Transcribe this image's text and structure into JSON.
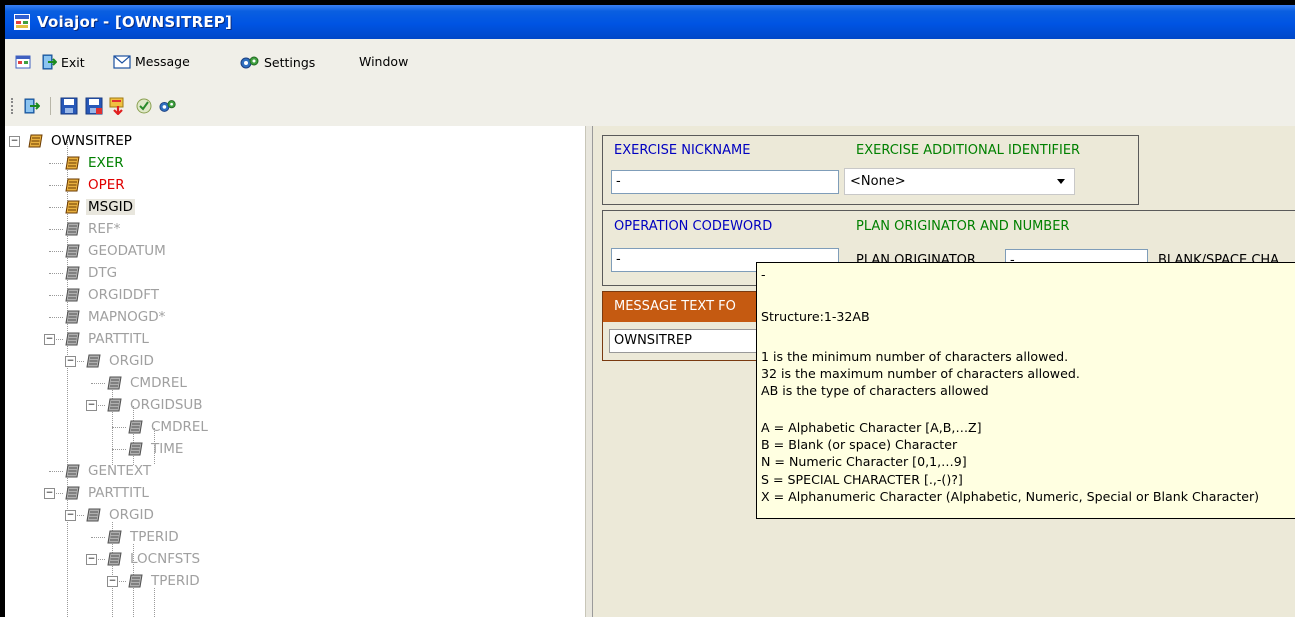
{
  "window": {
    "title": "Voiajor - [OWNSITREP]"
  },
  "menu": {
    "items": [
      {
        "label": "Exit",
        "icon": "exit-icon"
      },
      {
        "label": "Message",
        "icon": "envelope-icon"
      },
      {
        "label": "Settings",
        "icon": "settings-icon"
      },
      {
        "label": "Window",
        "icon": ""
      }
    ]
  },
  "toolbar": {
    "icons": [
      "exit-icon",
      "save-icon",
      "save-as-icon",
      "export-icon",
      "validate-icon",
      "settings-icon"
    ]
  },
  "tree": {
    "nodes": [
      {
        "label": "OWNSITREP",
        "color": "#000000",
        "expanded": true,
        "selected": false
      },
      {
        "label": "EXER",
        "color": "#008000"
      },
      {
        "label": "OPER",
        "color": "#e00000"
      },
      {
        "label": "MSGID",
        "color": "#000000",
        "selected": true
      },
      {
        "label": "REF*",
        "color": "#a0a0a0"
      },
      {
        "label": "GEODATUM",
        "color": "#a0a0a0"
      },
      {
        "label": "DTG",
        "color": "#a0a0a0"
      },
      {
        "label": "ORGIDDFT",
        "color": "#a0a0a0"
      },
      {
        "label": "MAPNOGD*",
        "color": "#a0a0a0"
      },
      {
        "label": "PARTTITL",
        "color": "#a0a0a0",
        "expanded": true
      },
      {
        "label": "ORGID",
        "color": "#a0a0a0",
        "expanded": true
      },
      {
        "label": "CMDREL",
        "color": "#a0a0a0"
      },
      {
        "label": "ORGIDSUB",
        "color": "#a0a0a0",
        "expanded": true
      },
      {
        "label": "CMDREL",
        "color": "#a0a0a0"
      },
      {
        "label": "TIME",
        "color": "#a0a0a0"
      },
      {
        "label": "GENTEXT",
        "color": "#a0a0a0"
      },
      {
        "label": "PARTTITL",
        "color": "#a0a0a0",
        "expanded": true
      },
      {
        "label": "ORGID",
        "color": "#a0a0a0",
        "expanded": true
      },
      {
        "label": "TPERID",
        "color": "#a0a0a0"
      },
      {
        "label": "LOCNFSTS",
        "color": "#a0a0a0",
        "expanded": true
      },
      {
        "label": "TPERID",
        "color": "#a0a0a0",
        "expanded": true
      }
    ]
  },
  "form": {
    "exercise_nickname": {
      "label": "EXERCISE NICKNAME",
      "value": "-",
      "label_color": "#0000c0"
    },
    "exercise_additional_identifier": {
      "label": "EXERCISE ADDITIONAL IDENTIFIER",
      "value": "<None>",
      "label_color": "#008000"
    },
    "operation_codeword": {
      "label": "OPERATION CODEWORD",
      "value": "-",
      "label_color": "#0000c0"
    },
    "plan_originator_and_number": {
      "label": "PLAN ORIGINATOR AND NUMBER",
      "label_color": "#008000"
    },
    "plan_originator": {
      "label": "PLAN ORIGINATOR",
      "value": "-"
    },
    "blank_space_char": {
      "label": "BLANK/SPACE CHA"
    },
    "message_text_format": {
      "label": "MESSAGE TEXT FO",
      "value": "OWNSITREP",
      "header_color": "#c55a11"
    }
  },
  "tooltip": {
    "lines": [
      "-",
      "Structure:1-32AB",
      "1   is the minimum number of characters allowed.",
      "32  is the maximum number of characters allowed.",
      "AB  is the type of characters allowed",
      "A = Alphabetic Character [A,B,…Z]",
      "B = Blank (or space) Character",
      "N = Numeric Character [0,1,…9]",
      "S = SPECIAL CHARACTER [.,-()?]",
      "X = Alphanumeric Character (Alphabetic, Numeric, Special or Blank Character)"
    ]
  }
}
